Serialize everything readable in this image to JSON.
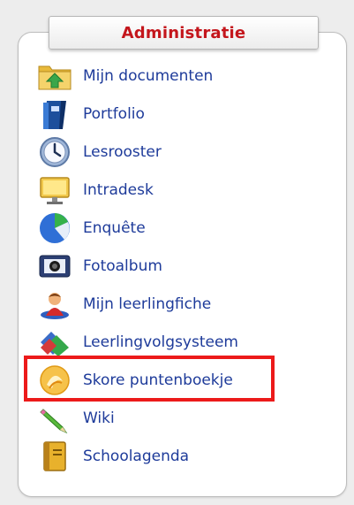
{
  "panel": {
    "title": "Administratie"
  },
  "menu": {
    "items": [
      {
        "label": "Mijn documenten",
        "icon": "folder-upload-icon"
      },
      {
        "label": "Portfolio",
        "icon": "portfolio-binder-icon"
      },
      {
        "label": "Lesrooster",
        "icon": "clock-icon"
      },
      {
        "label": "Intradesk",
        "icon": "monitor-icon"
      },
      {
        "label": "Enquête",
        "icon": "pie-chart-icon"
      },
      {
        "label": "Fotoalbum",
        "icon": "camera-icon"
      },
      {
        "label": "Mijn leerlingfiche",
        "icon": "student-icon"
      },
      {
        "label": "Leerlingvolgsysteem",
        "icon": "tracking-icon"
      },
      {
        "label": "Skore puntenboekje",
        "icon": "skore-icon",
        "highlighted": true
      },
      {
        "label": "Wiki",
        "icon": "pencil-icon"
      },
      {
        "label": "Schoolagenda",
        "icon": "agenda-book-icon"
      }
    ]
  },
  "colors": {
    "title": "#c4161c",
    "link": "#1e3b9a",
    "highlight_border": "#ec1a1a",
    "panel_border": "#bdbdbd",
    "background": "#ededed"
  }
}
